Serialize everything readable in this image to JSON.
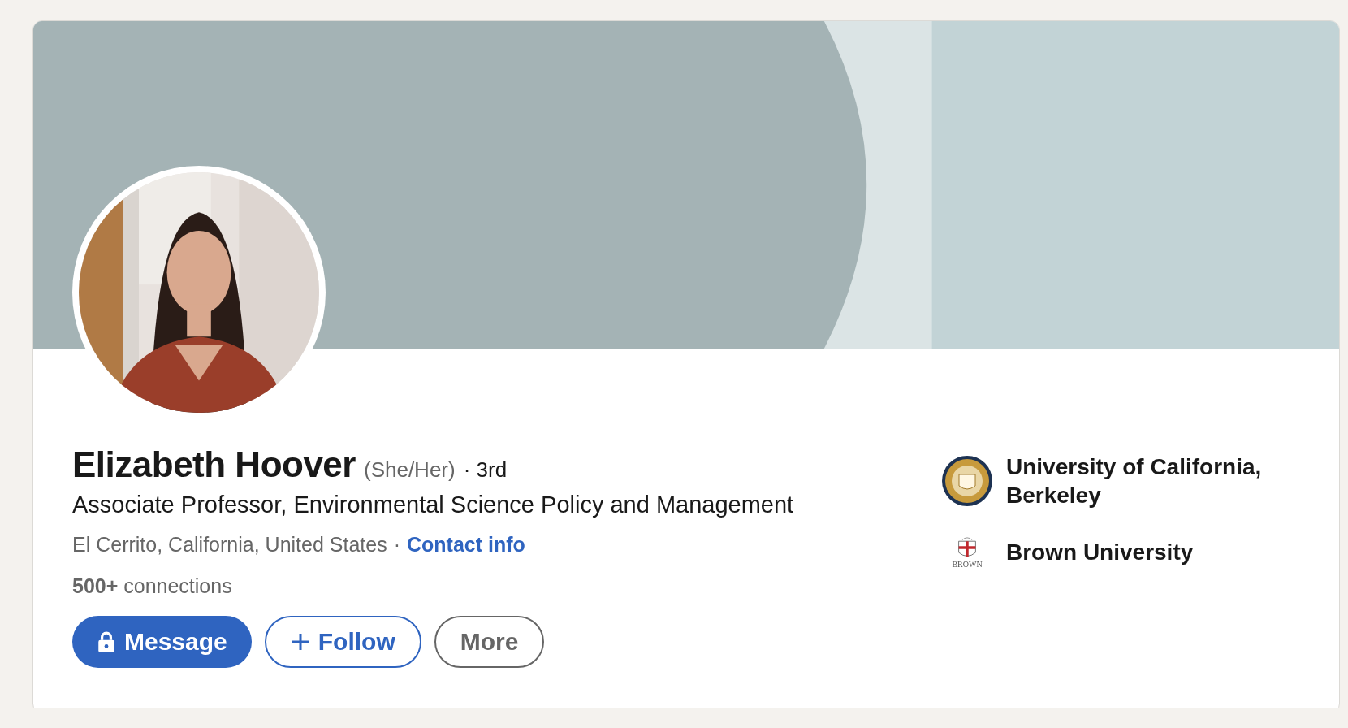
{
  "profile": {
    "name": "Elizabeth Hoover",
    "pronouns": "(She/Her)",
    "degree": "· 3rd",
    "headline": "Associate Professor, Environmental Science Policy and Management",
    "location": "El Cerrito, California, United States",
    "separator": "·",
    "contact_link": "Contact info",
    "connections": "**500+** connections"
  },
  "buttons": [
    {
      "label": "Message",
      "kind": "primary"
    },
    {
      "label": "Follow",
      "kind": "secondary"
    },
    {
      "label": "More",
      "kind": "tertiary"
    }
  ],
  "schools": [
    {
      "name": "University of California, Berkeley",
      "kind": "seal"
    },
    {
      "name": "Brown University",
      "kind": "shield",
      "logo_text": "BROWN"
    }
  ]
}
